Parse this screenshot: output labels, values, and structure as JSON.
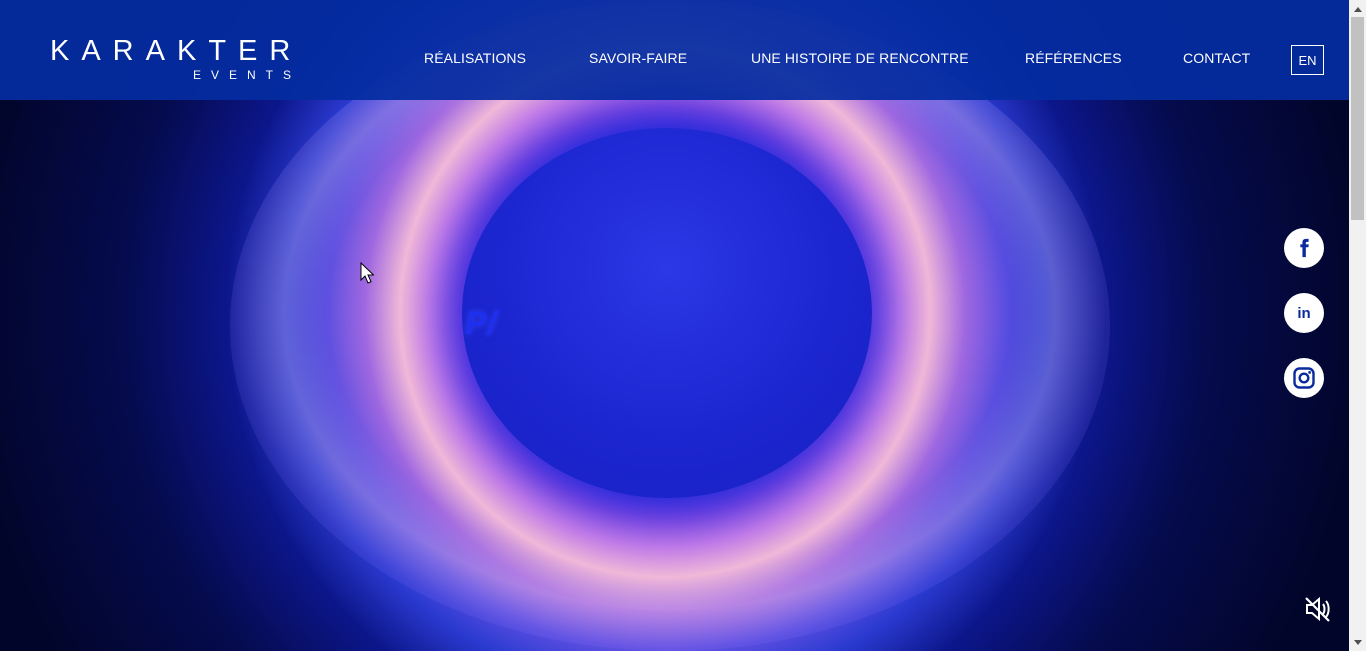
{
  "header": {
    "logo_main": "KARAKTER",
    "logo_sub": "EVENTS",
    "nav": [
      {
        "label": "RÉALISATIONS"
      },
      {
        "label": "SAVOIR-FAIRE"
      },
      {
        "label": "UNE HISTOIRE DE RENCONTRE"
      },
      {
        "label": "RÉFÉRENCES"
      },
      {
        "label": "CONTACT"
      }
    ],
    "language_button": "EN"
  },
  "hero": {
    "caption_fragment": "P/",
    "background_style": "blue particle ring video"
  },
  "social": [
    {
      "icon": "facebook-icon"
    },
    {
      "icon": "linkedin-icon",
      "label": "in"
    },
    {
      "icon": "instagram-icon"
    }
  ],
  "video": {
    "sound_state": "muted",
    "icon": "mute-icon"
  },
  "colors": {
    "header_bg": "#042ca0",
    "accent_text": "#ffffff",
    "social_icon": "#0a2a9e"
  }
}
